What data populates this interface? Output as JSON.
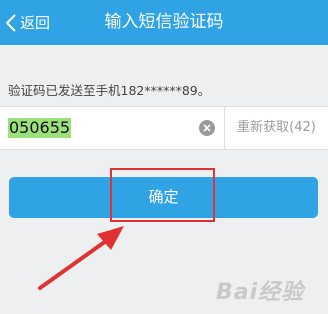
{
  "nav": {
    "back_label": "返回",
    "title": "输入短信验证码"
  },
  "hint_text": "验证码已发送至手机182******89。",
  "code_input": {
    "value": "050655"
  },
  "resend_label": "重新获取(42)",
  "confirm_label": "确定",
  "watermark": "Bai经验",
  "colors": {
    "nav_bg": "#2fa3e3",
    "button_bg": "#2fa3e3",
    "highlight_box": "#e03232",
    "selected_text_bg": "#9be07a"
  }
}
